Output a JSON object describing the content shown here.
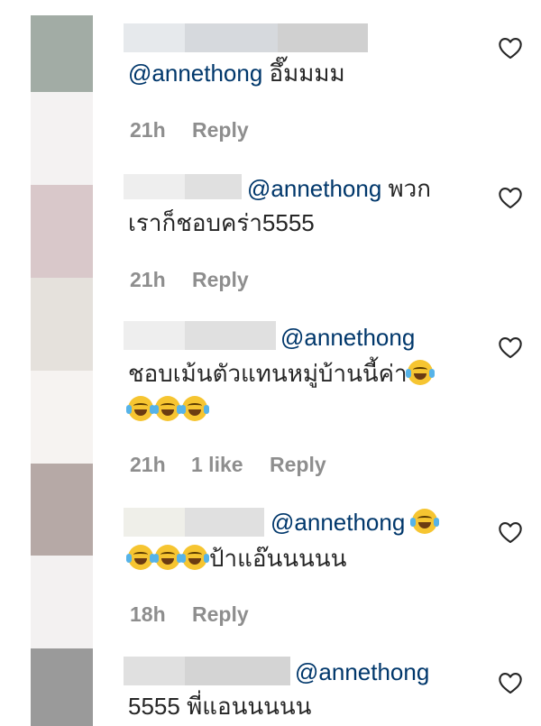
{
  "comments": [
    {
      "mention": "@annethong",
      "text": " อึ๊มมมม",
      "continuation": "",
      "time": "21h",
      "likes": "",
      "reply": "Reply"
    },
    {
      "mention": "@annethong",
      "text": " พวก",
      "continuation": "เราก็ชอบคร่า5555",
      "time": "21h",
      "likes": "",
      "reply": "Reply"
    },
    {
      "mention": "@annethong",
      "text": "",
      "continuation": "ชอบเม้นตัวแทนหมู่บ้านนี้ค่า",
      "time": "21h",
      "likes": "1 like",
      "reply": "Reply"
    },
    {
      "mention": "@annethong",
      "text": " ",
      "continuation": "ป้าแอ๊นนนนน",
      "time": "18h",
      "likes": "",
      "reply": "Reply"
    },
    {
      "mention": "@annethong",
      "text": "",
      "continuation": "5555 พี่แอนนนนน",
      "time": "",
      "likes": "",
      "reply": ""
    }
  ],
  "icons": {
    "like": "heart-outline-icon",
    "emoji": "face-with-tears-of-joy-icon"
  },
  "colors": {
    "mention": "#00376b",
    "meta": "#8e8e8e",
    "text": "#262626"
  }
}
